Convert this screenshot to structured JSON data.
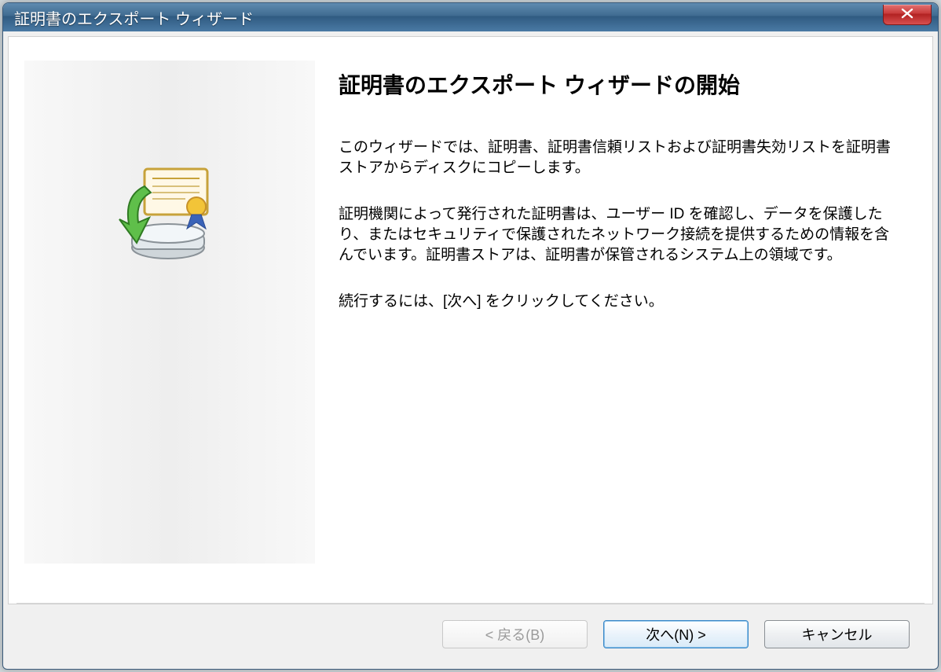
{
  "window": {
    "title": "証明書のエクスポート ウィザード"
  },
  "close_icon_name": "close-icon",
  "wizard": {
    "heading": "証明書のエクスポート ウィザードの開始",
    "para1": "このウィザードでは、証明書、証明書信頼リストおよび証明書失効リストを証明書ストアからディスクにコピーします。",
    "para2": "証明機関によって発行された証明書は、ユーザー ID を確認し、データを保護したり、またはセキュリティで保護されたネットワーク接続を提供するための情報を含んでいます。証明書ストアは、証明書が保管されるシステム上の領域です。",
    "para3": "続行するには、[次へ] をクリックしてください。"
  },
  "buttons": {
    "back": "< 戻る(B)",
    "next": "次へ(N) >",
    "cancel": "キャンセル"
  }
}
